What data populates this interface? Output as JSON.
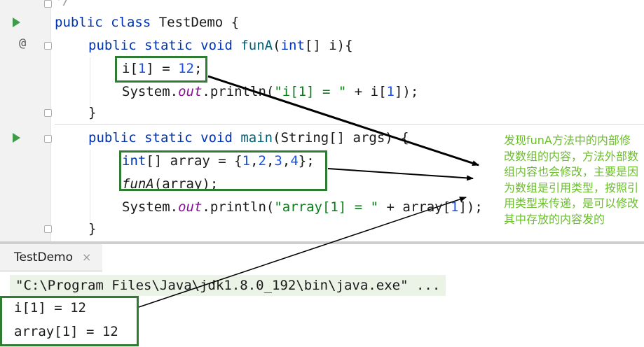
{
  "editor": {
    "top_fragment": "*/",
    "lines": {
      "class_decl": {
        "kw": "public class",
        "name": "TestDemo",
        "rest": " {"
      },
      "funA_decl": {
        "kw": "public static void",
        "name": "funA",
        "params_open": "(",
        "param_kw": "int",
        "params_rest": "[] i){"
      },
      "assign": {
        "pre": "i[",
        "idx": "1",
        "mid": "] = ",
        "val": "12",
        "end": ";"
      },
      "println1": {
        "pre": "System.",
        "field": "out",
        "call": ".println(",
        "str": "\"i[1] = \"",
        "op": " + i[",
        "idx": "1",
        "end": "]);"
      },
      "close1": "}",
      "main_decl": {
        "kw": "public static void",
        "name": "main",
        "rest": "(String[] args) {"
      },
      "array_decl": {
        "kw": "int",
        "mid": "[] array = {",
        "n1": "1",
        "n2": "2",
        "n3": "3",
        "n4": "4",
        "end": "};"
      },
      "call_funA": {
        "name": "funA",
        "rest": "(array);"
      },
      "println2": {
        "pre": "System.",
        "field": "out",
        "call": ".println(",
        "str": "\"array[1] = \"",
        "op": " + array[",
        "idx": "1",
        "end": "]);"
      },
      "close2": "}"
    },
    "gutter": {
      "at_symbol": "@"
    }
  },
  "annotation": {
    "text": "发现funA方法中的内部修改数组的内容，方法外部数组内容也会修改，主要是因为数组是引用类型，按照引用类型来传递，是可以修改其中存放的内容发的",
    "color": "#6abf2a"
  },
  "run_panel": {
    "tab_label": "TestDemo",
    "tab_close": "×",
    "command": "\"C:\\Program Files\\Java\\jdk1.8.0_192\\bin\\java.exe\" ...",
    "output": [
      "i[1] = 12",
      "array[1] = 12"
    ]
  },
  "colors": {
    "keyword": "#0033b3",
    "function": "#00627a",
    "number": "#1750eb",
    "string": "#067d17",
    "highlight_box": "#2e7d32",
    "arrow": "#000000"
  }
}
